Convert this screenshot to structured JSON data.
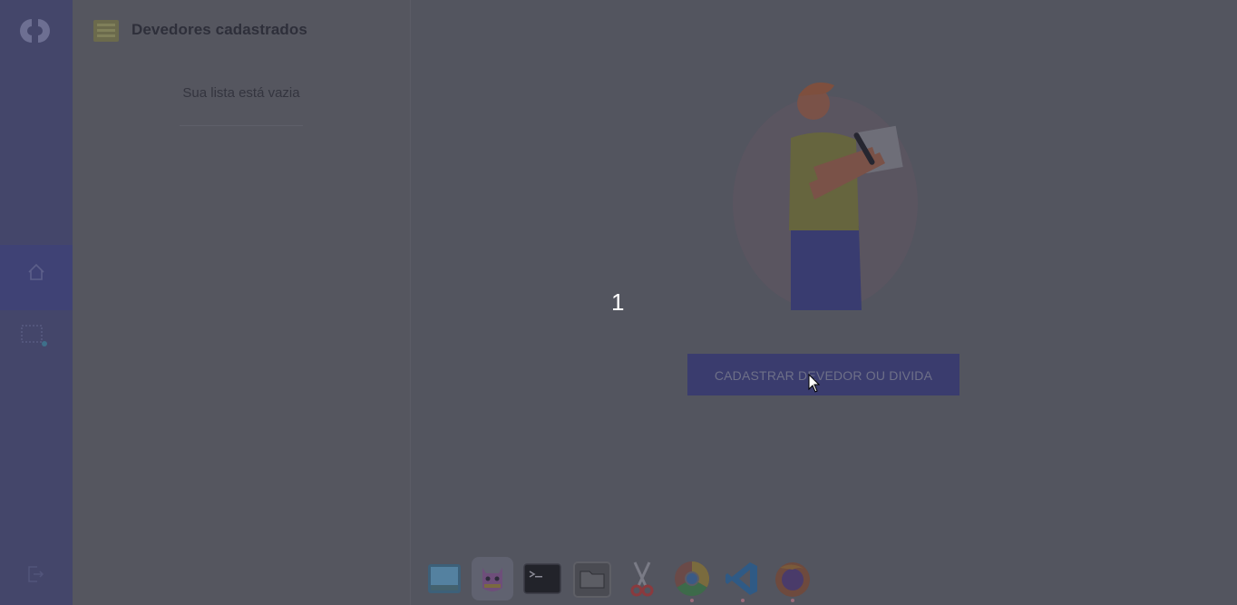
{
  "panel": {
    "title": "Devedores cadastrados",
    "empty_message": "Sua lista está vazia"
  },
  "main": {
    "counter": "1",
    "cta_label": "CADASTRAR DEVEDOR OU DIVIDA"
  },
  "rail": {
    "logo_icon": "logo-icon",
    "items": [
      {
        "icon": "home-icon",
        "active": true
      },
      {
        "icon": "add-user-icon",
        "active": false
      },
      {
        "icon": "logout-icon",
        "active": false
      }
    ]
  },
  "dock": {
    "items": [
      {
        "name": "image-viewer",
        "icon": "image-viewer-icon"
      },
      {
        "name": "gifcap",
        "icon": "gifcap-icon",
        "active": true
      },
      {
        "name": "terminal",
        "icon": "terminal-icon"
      },
      {
        "name": "files",
        "icon": "folder-icon"
      },
      {
        "name": "screenshot",
        "icon": "scissors-icon"
      },
      {
        "name": "chrome",
        "icon": "chrome-icon"
      },
      {
        "name": "vscode",
        "icon": "vscode-icon"
      },
      {
        "name": "firefox",
        "icon": "firefox-icon"
      }
    ]
  },
  "colors": {
    "overlay": "#53555f",
    "rail": "#44466a",
    "accent": "#3a3c6e"
  }
}
